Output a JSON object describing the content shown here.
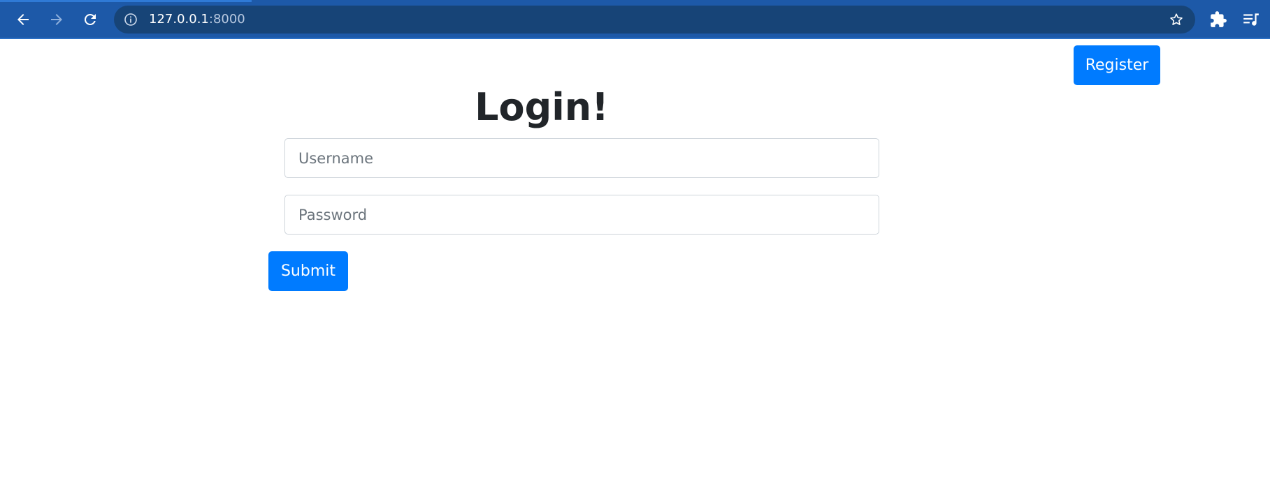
{
  "browser": {
    "url_host": "127.0.0.1",
    "url_port": ":8000",
    "icons": {
      "back": "arrow-left-icon",
      "forward": "arrow-right-icon",
      "reload": "reload-icon",
      "site_info": "info-icon",
      "bookmark": "star-icon",
      "extensions": "puzzle-icon",
      "media": "media-queue-icon"
    },
    "colors": {
      "toolbar": "#1d59a8",
      "omnibox": "#174477"
    }
  },
  "page": {
    "register_label": "Register",
    "title": "Login!",
    "username_placeholder": "Username",
    "password_placeholder": "Password",
    "submit_label": "Submit",
    "colors": {
      "primary": "#007bff",
      "title": "#212529",
      "input_border": "#ced4da"
    }
  }
}
